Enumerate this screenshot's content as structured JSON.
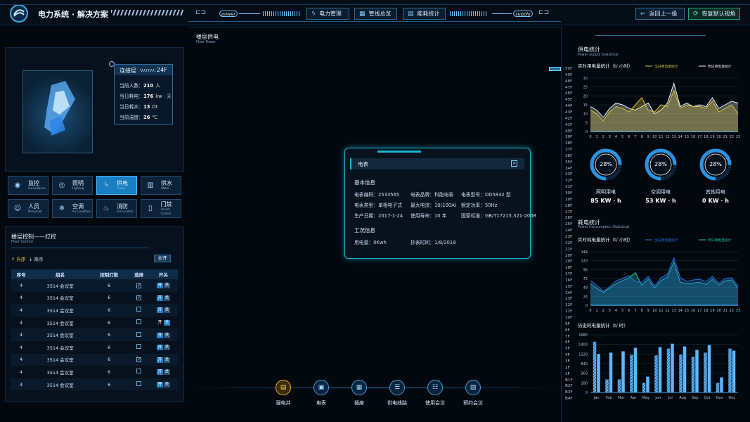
{
  "header": {
    "title": "电力系统 · 解决方案",
    "pill_left": "power",
    "pill_right": "supply",
    "nav": [
      "电力管理",
      "管线总览",
      "能耗统计"
    ],
    "back_label": "返回上一级",
    "reset_label": "恢复默认视角"
  },
  "building_info": {
    "floor_name": "连接层",
    "floor_no": "24F",
    "rows": [
      {
        "label": "当前人数：",
        "value": "210",
        "unit": "人"
      },
      {
        "label": "当日耗电：",
        "value": "176",
        "unit": "kw · 天"
      },
      {
        "label": "当日耗水：",
        "value": "13",
        "unit": "Dt"
      },
      {
        "label": "当前温度：",
        "value": "26",
        "unit": "℃"
      }
    ]
  },
  "systems": [
    {
      "cn": "监控",
      "en": "Surveillance",
      "icon": "camera-icon"
    },
    {
      "cn": "照明",
      "en": "Lighting",
      "icon": "bulb-icon"
    },
    {
      "cn": "供电",
      "en": "Power",
      "icon": "bolt-icon",
      "active": true
    },
    {
      "cn": "供水",
      "en": "Water",
      "icon": "water-icon"
    },
    {
      "cn": "人员",
      "en": "Personnel",
      "icon": "people-icon"
    },
    {
      "cn": "空调",
      "en": "Air Condition",
      "icon": "ac-icon"
    },
    {
      "cn": "消防",
      "en": "Fire Control",
      "icon": "fire-icon"
    },
    {
      "cn": "门禁",
      "en": "Access Control",
      "icon": "door-icon"
    }
  ],
  "floor_control": {
    "title": "楼层控制——灯控",
    "subtitle": "Floor Control",
    "sort_asc": "升序",
    "sort_desc": "降序",
    "all_on": "全开",
    "columns": [
      "序号",
      "组名",
      "控制灯数",
      "选择",
      "开关"
    ],
    "rows": [
      {
        "no": "4",
        "group": "3514 会议室",
        "count": "6",
        "checked": true,
        "on": "开",
        "off": "关"
      },
      {
        "no": "4",
        "group": "3514 会议室",
        "count": "6",
        "checked": true,
        "on": "开",
        "off": "关"
      },
      {
        "no": "4",
        "group": "3514 会议室",
        "count": "6",
        "checked": false,
        "on": "开",
        "off": "关"
      },
      {
        "no": "4",
        "group": "3514 会议室",
        "count": "6",
        "checked": false,
        "on": "开",
        "off": "关",
        "state_off": true
      },
      {
        "no": "4",
        "group": "3514 会议室",
        "count": "6",
        "checked": false,
        "on": "开",
        "off": "关"
      },
      {
        "no": "4",
        "group": "3514 会议室",
        "count": "6",
        "checked": false,
        "on": "开",
        "off": "关"
      },
      {
        "no": "4",
        "group": "3514 会议室",
        "count": "6",
        "checked": true,
        "on": "开",
        "off": "关"
      },
      {
        "no": "4",
        "group": "3514 会议室",
        "count": "6",
        "checked": false,
        "on": "开",
        "off": "关"
      },
      {
        "no": "4",
        "group": "3514 会议室",
        "count": "6",
        "checked": false,
        "on": "开",
        "off": "关"
      }
    ]
  },
  "center": {
    "title": "楼层供电",
    "subtitle": "Floor Power"
  },
  "meter_modal": {
    "title": "电表",
    "basic_title": "基本信息",
    "basic": [
      [
        "电表编码：",
        "2533565"
      ],
      [
        "电表品牌：",
        "科能电表"
      ],
      [
        "电表型号：",
        "DD5832 型"
      ],
      [
        "电表类型：",
        "单相电子式"
      ],
      [
        "最大电流：",
        "10(100A)"
      ],
      [
        "额定功率：",
        "50Hz"
      ],
      [
        "生产日期：",
        "2017-1-24"
      ],
      [
        "使用寿命：",
        "10 年"
      ],
      [
        "国家标准：",
        "GB/T17215.321-2008"
      ]
    ],
    "status_title": "工况信息",
    "status": [
      [
        "用电量：",
        "0Kwh"
      ],
      [
        "抄表时间：",
        "1/8/2019"
      ]
    ]
  },
  "bottom_nav": [
    {
      "label": "强电井",
      "icon": "cabinet-icon",
      "selected": true
    },
    {
      "label": "电表",
      "icon": "meter-icon"
    },
    {
      "label": "插座",
      "icon": "socket-icon"
    },
    {
      "label": "供电线路",
      "icon": "line-icon"
    },
    {
      "label": "使用会议",
      "icon": "meeting-icon"
    },
    {
      "label": "预约会议",
      "icon": "booking-icon"
    }
  ],
  "floors": [
    "50F",
    "49F",
    "48F",
    "47F",
    "46F",
    "45F",
    "44F",
    "43F",
    "42F",
    "41F",
    "40F",
    "39F",
    "38F",
    "37F",
    "36F",
    "35F",
    "34F",
    "33F",
    "32F",
    "31F",
    "30F",
    "29F",
    "28F",
    "27F",
    "26F",
    "25F",
    "24F",
    "23F",
    "22F",
    "21F",
    "20F",
    "19F",
    "18F",
    "17F",
    "16F",
    "15F",
    "14F",
    "13F",
    "12F",
    "11F",
    "10F",
    "9F",
    "8F",
    "7F",
    "6F",
    "5F",
    "4F",
    "3F",
    "2F",
    "1F",
    "B1F",
    "B2F",
    "B3F",
    "B4F"
  ],
  "supply_stats": {
    "title": "供电统计",
    "subtitle": "Power Supply Statistical",
    "gauges": [
      {
        "percent": "28%",
        "label": "照明用电",
        "value": "85",
        "unit": "KW · h"
      },
      {
        "percent": "28%",
        "label": "空调用电",
        "value": "53",
        "unit": "KW · h"
      },
      {
        "percent": "28%",
        "label": "其他用电",
        "value": "0",
        "unit": "KW · h"
      }
    ]
  },
  "consume_stats": {
    "title": "耗电统计",
    "subtitle": "Power Consumption Statistical"
  },
  "chart_data": [
    {
      "type": "area",
      "title": "实时用电量统计（t/ 小时）",
      "ylim": [
        0,
        30
      ],
      "yticks": [
        0,
        5,
        10,
        15,
        20,
        25,
        30
      ],
      "x": [
        0,
        1,
        2,
        3,
        4,
        5,
        6,
        7,
        8,
        9,
        10,
        11,
        12,
        13,
        14,
        15,
        16,
        17,
        18,
        19,
        20,
        21,
        22,
        23
      ],
      "series": [
        {
          "name": "当日用电量统计",
          "color": "#d6c23a",
          "values": [
            12,
            10,
            6,
            11,
            14,
            13,
            11,
            15,
            19,
            12,
            11,
            15,
            14,
            23,
            13,
            15,
            14,
            14,
            13,
            17,
            11,
            13,
            15,
            10
          ]
        },
        {
          "name": "昨日用电量统计",
          "color": "#e8eef5",
          "values": [
            14,
            12,
            8,
            13,
            16,
            15,
            13,
            12,
            14,
            16,
            10,
            12,
            16,
            27,
            14,
            16,
            14,
            15,
            14,
            19,
            13,
            15,
            17,
            16
          ]
        }
      ],
      "grid": true
    },
    {
      "type": "area",
      "title": "实时耗电量统计（t/ 小时）",
      "ylim": [
        0,
        144
      ],
      "yticks": [
        0,
        24,
        48,
        72,
        96,
        120,
        144
      ],
      "x": [
        0,
        1,
        2,
        3,
        4,
        5,
        6,
        7,
        8,
        9,
        10,
        11,
        12,
        13,
        14,
        15,
        16,
        17,
        18,
        19,
        20,
        21,
        22,
        23
      ],
      "series": [
        {
          "name": "当日用电量统计",
          "color": "#2f6fd8",
          "values": [
            66,
            54,
            38,
            50,
            66,
            72,
            80,
            64,
            62,
            78,
            52,
            74,
            84,
            128,
            74,
            64,
            68,
            70,
            64,
            78,
            60,
            72,
            74,
            52
          ]
        },
        {
          "name": "昨日用电量统计",
          "color": "#1fc3a8",
          "values": [
            58,
            46,
            34,
            46,
            58,
            66,
            74,
            88,
            54,
            70,
            46,
            66,
            76,
            116,
            62,
            58,
            60,
            62,
            56,
            70,
            54,
            66,
            68,
            46
          ]
        }
      ],
      "grid": true
    },
    {
      "type": "bar",
      "title": "历史耗电量统计（t/ 时）",
      "ylim": [
        0,
        1680
      ],
      "yticks": [
        0,
        280,
        560,
        840,
        1120,
        1400,
        1680
      ],
      "categories": [
        "Jan",
        "Feb",
        "Mar",
        "Apr",
        "May",
        "Jun",
        "Jul",
        "Aug",
        "Sep",
        "Oct",
        "Nov",
        "Dec"
      ],
      "series": [
        {
          "values": [
            1480,
            380,
            380,
            1100,
            280,
            1080,
            1280,
            1100,
            1040,
            1160,
            280,
            1280
          ]
        },
        {
          "values": [
            1120,
            1160,
            1200,
            1300,
            460,
            1320,
            1420,
            1340,
            1240,
            1380,
            440,
            1220
          ]
        }
      ],
      "grid": true
    }
  ]
}
